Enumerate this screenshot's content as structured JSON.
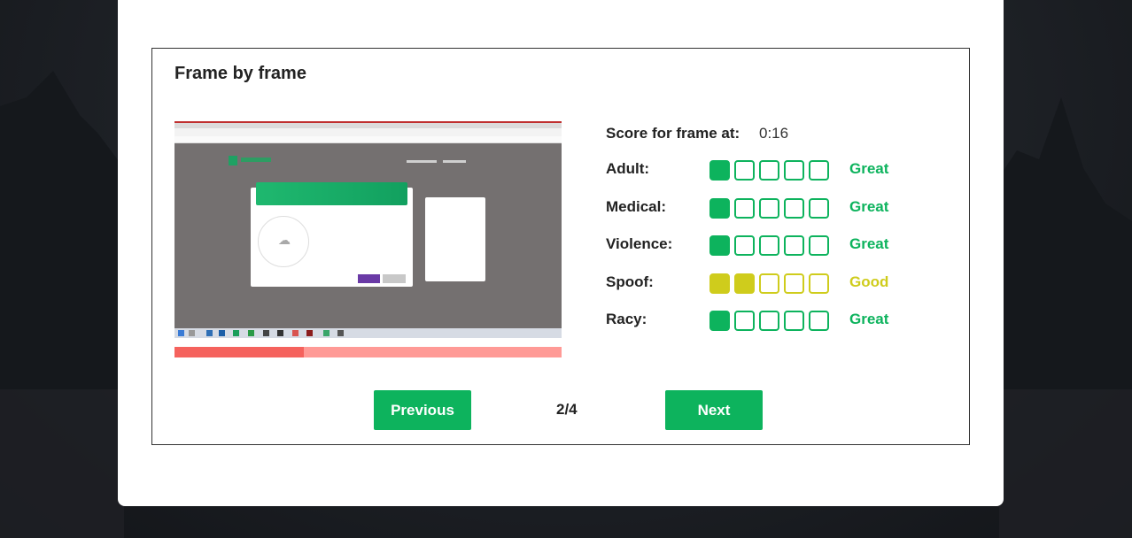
{
  "panel": {
    "title": "Frame by frame"
  },
  "frame": {
    "progress_fraction": 0.335
  },
  "scores": {
    "heading": "Score for frame at:",
    "time": "0:16",
    "max": 5,
    "rows": [
      {
        "label": "Adult:",
        "score": 1,
        "rating": "Great",
        "color": "#0db35d"
      },
      {
        "label": "Medical:",
        "score": 1,
        "rating": "Great",
        "color": "#0db35d"
      },
      {
        "label": "Violence:",
        "score": 1,
        "rating": "Great",
        "color": "#0db35d"
      },
      {
        "label": "Spoof:",
        "score": 2,
        "rating": "Good",
        "color": "#cfcc1c"
      },
      {
        "label": "Racy:",
        "score": 1,
        "rating": "Great",
        "color": "#0db35d"
      }
    ]
  },
  "pagination": {
    "previous_label": "Previous",
    "next_label": "Next",
    "page": "2/4"
  },
  "colors": {
    "accent": "#0db35d",
    "progress_fill": "#f5625d",
    "progress_track": "#ff9a96"
  }
}
